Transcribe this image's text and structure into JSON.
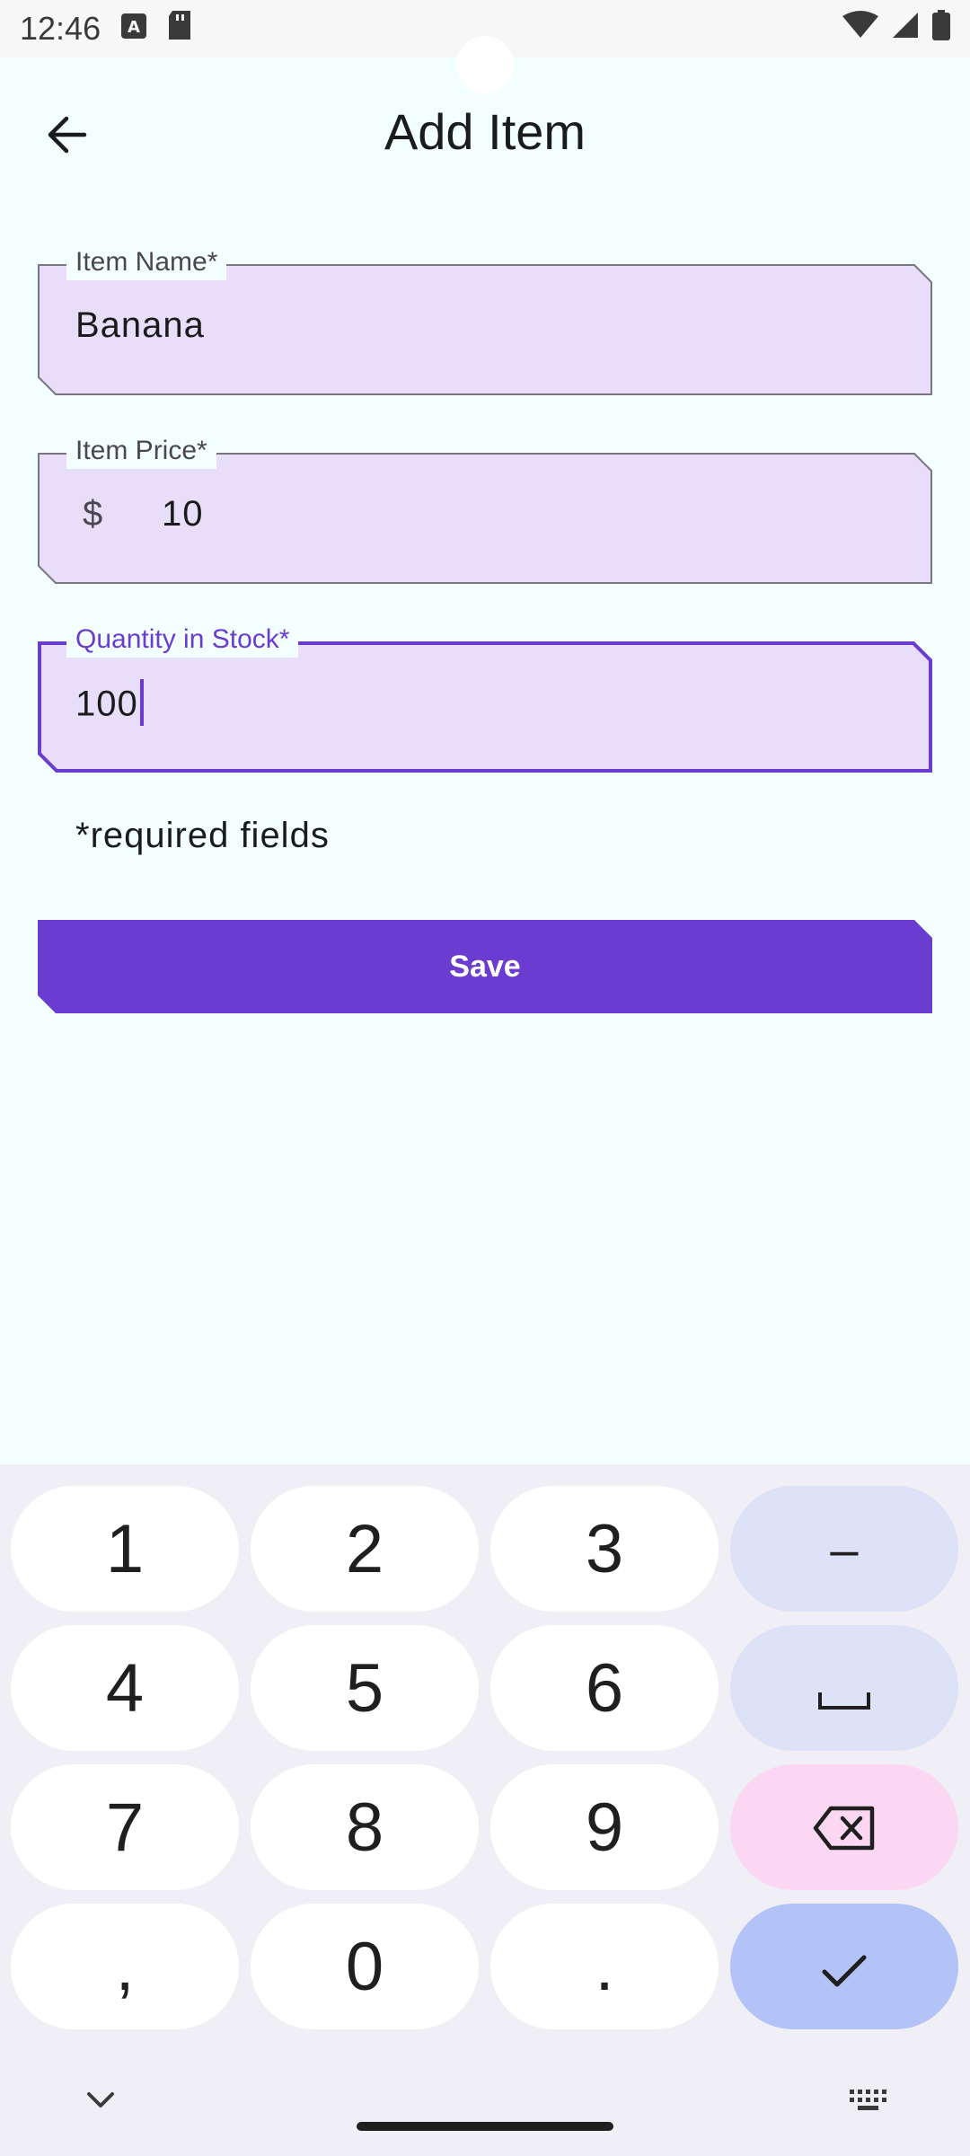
{
  "status_bar": {
    "time": "12:46"
  },
  "app_bar": {
    "title": "Add Item"
  },
  "form": {
    "item_name": {
      "label": "Item Name*",
      "value": "Banana"
    },
    "item_price": {
      "label": "Item Price*",
      "prefix": "$",
      "value": "10"
    },
    "quantity": {
      "label": "Quantity in Stock*",
      "value": "100"
    },
    "required_note": "*required fields",
    "save_label": "Save"
  },
  "keyboard": {
    "keys": [
      "1",
      "2",
      "3",
      "–",
      "4",
      "5",
      "6",
      "space",
      "7",
      "8",
      "9",
      "backspace",
      ",",
      "0",
      ".",
      "done"
    ],
    "labels": {
      "k1": "1",
      "k2": "2",
      "k3": "3",
      "minus": "–",
      "k4": "4",
      "k5": "5",
      "k6": "6",
      "k7": "7",
      "k8": "8",
      "k9": "9",
      "comma": ",",
      "k0": "0",
      "period": "."
    }
  },
  "colors": {
    "accent": "#6a3dd0",
    "field_fill": "#e8defa",
    "background": "#f3fffe",
    "key_fn": "#dde2f6",
    "key_delete": "#fbd7f3",
    "key_done": "#b3c3f8"
  }
}
